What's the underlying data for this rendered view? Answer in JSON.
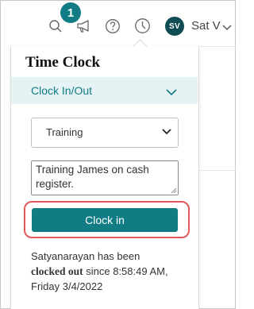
{
  "header": {
    "notification_count": "1",
    "icons": [
      "search-icon",
      "megaphone-icon",
      "help-icon",
      "clock-icon",
      "chevron-down-icon"
    ],
    "user": {
      "initials": "SV",
      "name": "Sat V"
    }
  },
  "panel": {
    "title": "Time Clock",
    "section": {
      "label": "Clock In/Out"
    },
    "activity_select": {
      "selected": "Training"
    },
    "note": {
      "value": "Training James on cash register."
    },
    "clock_button": {
      "label": "Clock in"
    },
    "status": {
      "prefix": "Satyanarayan has been",
      "state": "clocked out",
      "suffix": " since 8:58:49 AM,",
      "date_line": "Friday 3/4/2022"
    }
  },
  "colors": {
    "accent": "#127c84",
    "avatar": "#0f4c54",
    "highlight": "#e05a5a",
    "section_bg": "#e6f3f4"
  }
}
